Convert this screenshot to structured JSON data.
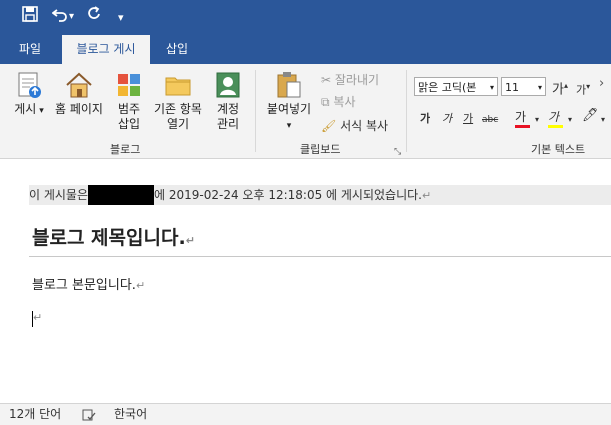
{
  "qat": {
    "customize_label": "▾"
  },
  "tabs": [
    {
      "label": "파일"
    },
    {
      "label": "블로그 게시"
    },
    {
      "label": "삽입"
    }
  ],
  "ribbon": {
    "blog_group": {
      "label": "블로그",
      "publish": "게시",
      "home": "홈 페이지",
      "category_1": "범주",
      "category_2": "삽입",
      "open_1": "기존 항목",
      "open_2": "열기",
      "accounts_1": "계정",
      "accounts_2": "관리"
    },
    "clipboard_group": {
      "label": "클립보드",
      "paste": "붙여넣기",
      "cut": "잘라내기",
      "copy": "복사",
      "format_painter": "서식 복사"
    },
    "font_group": {
      "label": "기본 텍스트",
      "font_name": "맑은 고딕(본",
      "font_size": "11",
      "grow": "가",
      "shrink": "가",
      "bold": "가",
      "italic": "가",
      "underline": "가",
      "strike": "abc",
      "font_color": "가",
      "highlight": "가",
      "font_color_hex": "#e81123",
      "highlight_hex": "#ffff00"
    }
  },
  "document": {
    "meta_prefix": "이 게시물은",
    "meta_suffix": "에 2019-02-24 오후 12:18:05 에 게시되었습니다.",
    "title": "블로그 제목입니다.",
    "body": "블로그 본문입니다.",
    "para_mark": "↵"
  },
  "status": {
    "word_count": "12개 단어",
    "language": "한국어"
  }
}
